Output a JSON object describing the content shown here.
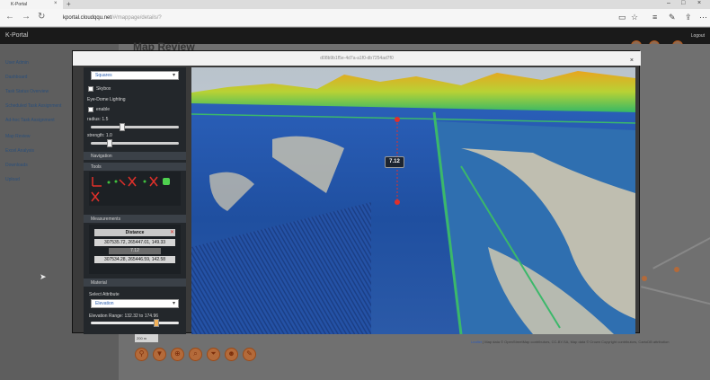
{
  "browser": {
    "tab_title": "K-Portal",
    "url_host": "kportal.cloudqqu.net",
    "url_path": "/#/mappage/details/?",
    "icons": [
      "back-arrow-icon",
      "forward-arrow-icon",
      "refresh-icon",
      "reading-view-icon",
      "star-icon",
      "hub-icon",
      "note-icon",
      "share-icon",
      "more-icon"
    ]
  },
  "app": {
    "brand": "K-Portal",
    "logout": "Logout",
    "page_title": "Map Review"
  },
  "sidebar": {
    "items": [
      {
        "label": "User Admin"
      },
      {
        "label": "Dashboard"
      },
      {
        "label": "Task Status Overview"
      },
      {
        "label": "Scheduled Task Assignment"
      },
      {
        "label": "Ad-hoc Task Assignment"
      },
      {
        "label": "Map Review"
      },
      {
        "label": "Excel Analysis"
      },
      {
        "label": "Downloads"
      },
      {
        "label": "Upload"
      }
    ]
  },
  "modal": {
    "title": "d08b9b1f5e-4d7a-a1f0-db7254ad7f0",
    "close": "×",
    "panel": {
      "shape_select": "Squares",
      "skybox_label": "Skybox",
      "edl_title": "Eye-Dome Lighting",
      "enable_label": "enable",
      "radius_label": "radius: 1.5",
      "strength_label": "strength: 1.0",
      "radius_fraction": 0.35,
      "strength_fraction": 0.2,
      "navigation_head": "Navigation",
      "tools_head": "Tools",
      "measurements_head": "Measurements",
      "measurement": {
        "title": "Distance",
        "point1": "307535.72, 265447.01, 149.33",
        "distance": "7.12",
        "point2": "307534.28, 265446.59, 142.58"
      },
      "material_head": "Material",
      "attribute_label": "Select Attribute",
      "attribute_select": "Elevation",
      "elevation_range_label": "Elevation Range: 132.32 to 174.96"
    },
    "viewport": {
      "distance_label": "7.12"
    }
  },
  "map": {
    "attribution_prefix": "Leaflet",
    "attribution_text": " | Map data © OpenStreetMap contributors, CC-BY-SA, Map data © Crown Copyright contributors, CartoDB attribution",
    "scale_label": "200 m",
    "tools": [
      "marker-icon",
      "filter-icon",
      "zoom-icon",
      "search-icon",
      "funnel-icon",
      "person-icon",
      "tag-icon"
    ]
  },
  "colors": {
    "accent_orange": "#b36a3a",
    "header_dark": "#1a1a1a",
    "panel_dark": "#23272b",
    "measure_red": "#e0302a"
  }
}
